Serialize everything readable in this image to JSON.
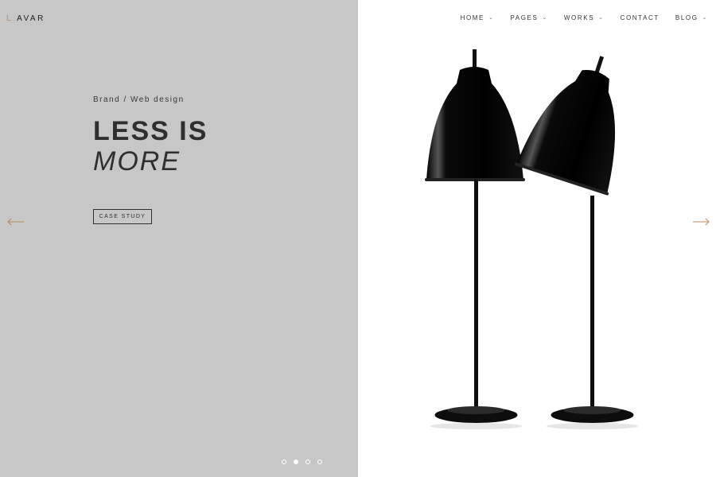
{
  "brand": {
    "logo_first": "L",
    "logo_rest": "AVAR"
  },
  "nav": {
    "items": [
      {
        "label": "HOME",
        "dropdown": true
      },
      {
        "label": "PAGES",
        "dropdown": true
      },
      {
        "label": "WORKS",
        "dropdown": true
      },
      {
        "label": "CONTACT",
        "dropdown": false
      },
      {
        "label": "BLOG",
        "dropdown": true
      }
    ],
    "caret": "⌄"
  },
  "hero": {
    "kicker": "Brand / Web design",
    "title_line1": "LESS IS",
    "title_line2": "MORE",
    "cta_label": "CASE STUDY"
  },
  "slider": {
    "slides": 4,
    "active_index": 1
  },
  "colors": {
    "left_bg": "#c7c7c7",
    "accent": "#b98a5e",
    "text": "#2f2f2f"
  }
}
